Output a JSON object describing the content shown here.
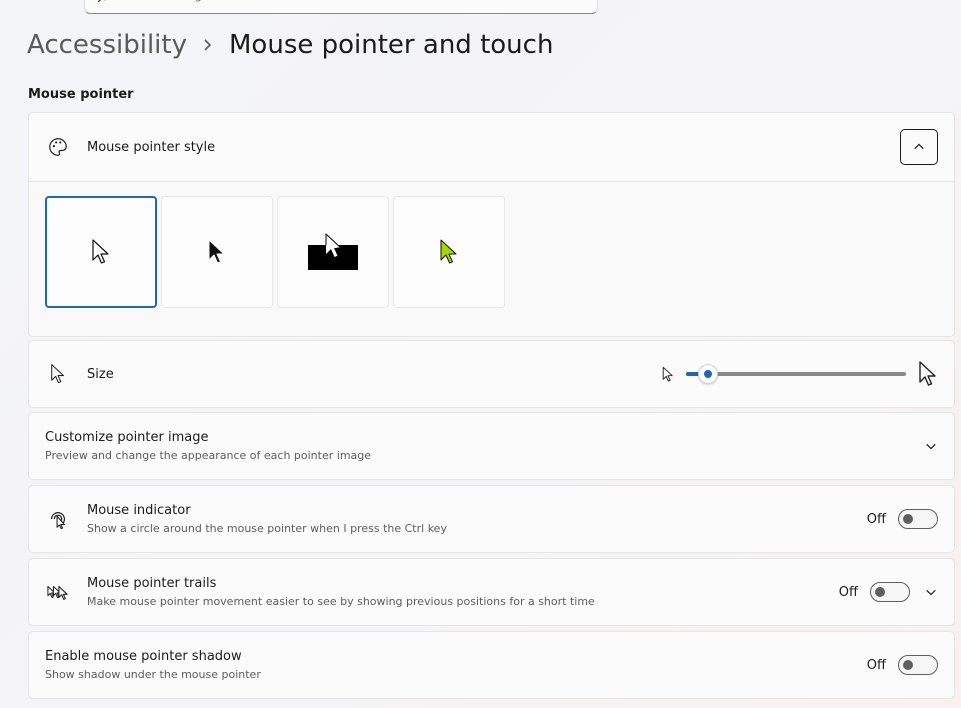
{
  "search": {
    "placeholder": "Find a setting"
  },
  "breadcrumb": {
    "parent": "Accessibility",
    "current": "Mouse pointer and touch"
  },
  "section": {
    "title": "Mouse pointer"
  },
  "pointer_style": {
    "title": "Mouse pointer style",
    "options": [
      {
        "name": "white",
        "selected": true
      },
      {
        "name": "black",
        "selected": false
      },
      {
        "name": "inverted",
        "selected": false
      },
      {
        "name": "custom-color",
        "selected": false,
        "color": "#a7d600"
      }
    ]
  },
  "size": {
    "title": "Size",
    "value_fraction": 0.1
  },
  "customize": {
    "title": "Customize pointer image",
    "subtitle": "Preview and change the appearance of each pointer image"
  },
  "indicator": {
    "title": "Mouse indicator",
    "subtitle": "Show a circle around the mouse pointer when I press the Ctrl key",
    "state": "Off"
  },
  "trails": {
    "title": "Mouse pointer trails",
    "subtitle": "Make mouse pointer movement easier to see by showing previous positions for a short time",
    "state": "Off"
  },
  "shadow": {
    "title": "Enable mouse pointer shadow",
    "subtitle": "Show shadow under the mouse pointer",
    "state": "Off"
  },
  "colors": {
    "accent": "#1d67b3"
  }
}
